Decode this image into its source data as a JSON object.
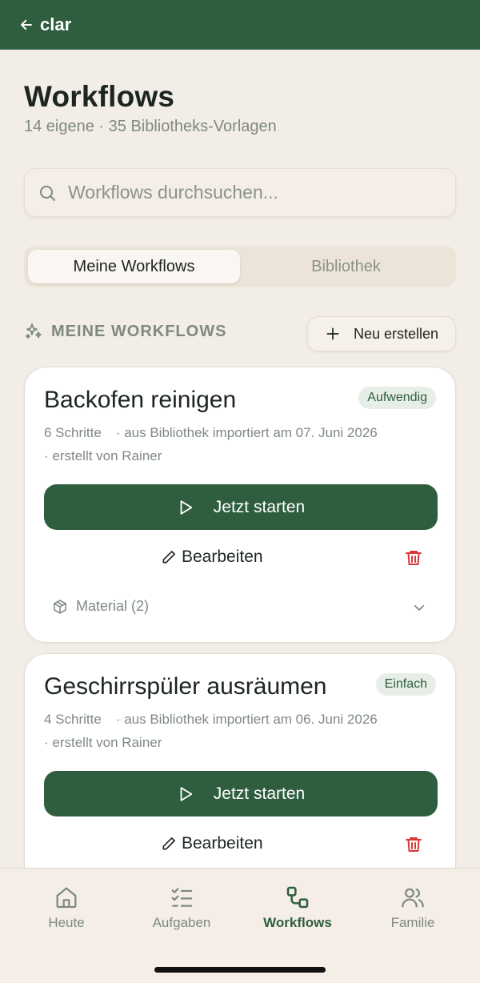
{
  "topbar": {
    "back_label": "clar"
  },
  "header": {
    "title": "Workflows",
    "subtitle": "14 eigene · 35 Bibliotheks-Vorlagen"
  },
  "search": {
    "placeholder": "Workflows durchsuchen..."
  },
  "segments": [
    {
      "label": "Meine Workflows",
      "active": true
    },
    {
      "label": "Bibliothek",
      "active": false
    }
  ],
  "section": {
    "heading": "MEINE WORKFLOWS",
    "new_button": "Neu erstellen"
  },
  "cards": [
    {
      "title": "Backofen reinigen",
      "badge": "Aufwendig",
      "steps": "6 Schritte",
      "source": "· aus Bibliothek importiert am 07. Juni 2026",
      "author": "· erstellt von Rainer",
      "start_label": "Jetzt starten",
      "edit_label": "Bearbeiten",
      "material_label": "Material (2)"
    },
    {
      "title": "Geschirrspüler ausräumen",
      "badge": "Einfach",
      "steps": "4 Schritte",
      "source": "· aus Bibliothek importiert am 06. Juni 2026",
      "author": "· erstellt von Rainer",
      "start_label": "Jetzt starten",
      "edit_label": "Bearbeiten"
    }
  ],
  "bottom_nav": [
    {
      "label": "Heute",
      "icon": "home-icon",
      "active": false
    },
    {
      "label": "Aufgaben",
      "icon": "checklist-icon",
      "active": false
    },
    {
      "label": "Workflows",
      "icon": "workflow-icon",
      "active": true
    },
    {
      "label": "Familie",
      "icon": "users-icon",
      "active": false
    }
  ],
  "colors": {
    "brand_green": "#2e5e3e",
    "background": "#f2ede6",
    "danger": "#d9383a"
  }
}
